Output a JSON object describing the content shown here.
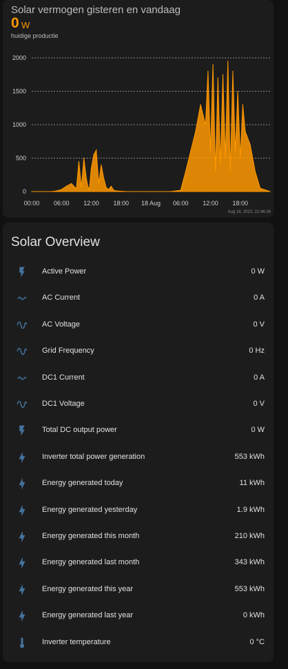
{
  "chart_card": {
    "title": "Solar vermogen gisteren en vandaag",
    "current_value": "0",
    "current_unit": "W",
    "subtitle": "huidige productie",
    "timestamp": "Aug 18, 2022, 22:46:34"
  },
  "chart_data": {
    "type": "area",
    "color": "#ff9800",
    "x_tick_labels": [
      "00:00",
      "06:00",
      "12:00",
      "18:00",
      "18 Aug",
      "06:00",
      "12:00",
      "18:00"
    ],
    "x_unit": "hours since 17 Aug 00:00",
    "ylim": [
      0,
      2000
    ],
    "y_ticks": [
      0,
      500,
      1000,
      1500,
      2000
    ],
    "grid": true,
    "x": [
      0,
      4,
      5,
      6,
      7,
      8,
      9,
      9.5,
      10,
      10.5,
      11,
      11.3,
      11.6,
      12,
      12.5,
      13,
      13.5,
      14,
      14.5,
      15,
      15.5,
      16,
      16.5,
      17,
      18,
      19,
      20,
      24,
      28,
      30,
      31,
      32,
      33,
      34,
      35,
      35.5,
      36,
      36.5,
      37,
      37.5,
      38,
      38.5,
      39,
      39.5,
      40,
      40.5,
      41,
      41.5,
      42,
      42.5,
      43,
      44,
      45,
      46,
      48
    ],
    "y": [
      0,
      0,
      10,
      30,
      80,
      120,
      40,
      450,
      60,
      500,
      200,
      80,
      30,
      350,
      550,
      620,
      120,
      400,
      200,
      60,
      30,
      80,
      20,
      10,
      5,
      0,
      0,
      0,
      0,
      20,
      300,
      600,
      900,
      1300,
      1000,
      1800,
      600,
      1900,
      300,
      1700,
      400,
      1750,
      500,
      1950,
      300,
      1800,
      600,
      1500,
      500,
      1300,
      900,
      700,
      300,
      50,
      0
    ]
  },
  "overview": {
    "title": "Solar Overview",
    "rows": [
      {
        "icon": "flash-icon",
        "label": "Active Power",
        "value": "0 W"
      },
      {
        "icon": "current-ac-icon",
        "label": "AC Current",
        "value": "0 A"
      },
      {
        "icon": "sine-wave-icon",
        "label": "AC Voltage",
        "value": "0 V"
      },
      {
        "icon": "sine-wave-icon",
        "label": "Grid Frequency",
        "value": "0 Hz"
      },
      {
        "icon": "current-ac-icon",
        "label": "DC1 Current",
        "value": "0 A"
      },
      {
        "icon": "sine-wave-icon",
        "label": "DC1 Voltage",
        "value": "0 V"
      },
      {
        "icon": "flash-icon",
        "label": "Total DC output power",
        "value": "0 W"
      },
      {
        "icon": "lightning-bolt-icon",
        "label": "Inverter total power generation",
        "value": "553 kWh"
      },
      {
        "icon": "lightning-bolt-icon",
        "label": "Energy generated today",
        "value": "11 kWh"
      },
      {
        "icon": "lightning-bolt-icon",
        "label": "Energy generated yesterday",
        "value": "1.9 kWh"
      },
      {
        "icon": "lightning-bolt-icon",
        "label": "Energy generated this month",
        "value": "210 kWh"
      },
      {
        "icon": "lightning-bolt-icon",
        "label": "Energy generated last month",
        "value": "343 kWh"
      },
      {
        "icon": "lightning-bolt-icon",
        "label": "Energy generated this year",
        "value": "553 kWh"
      },
      {
        "icon": "lightning-bolt-icon",
        "label": "Energy generated last year",
        "value": "0 kWh"
      },
      {
        "icon": "thermometer-icon",
        "label": "Inverter temperature",
        "value": "0 °C"
      }
    ]
  },
  "colors": {
    "background": "#111111",
    "card": "#1c1c1c",
    "accent": "#ff9800",
    "icon": "#44739e"
  }
}
